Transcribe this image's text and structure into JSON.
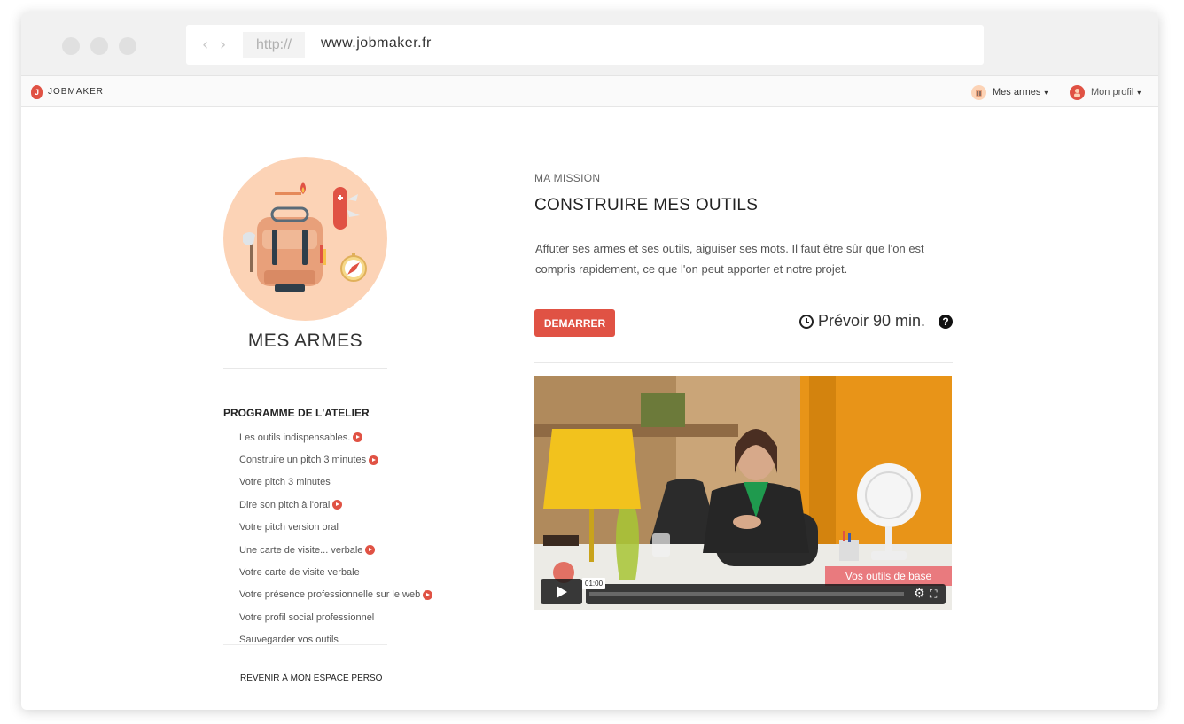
{
  "browser": {
    "protocol": "http://",
    "url": "www.jobmaker.fr",
    "back_glyph": "‹",
    "forward_glyph": "›"
  },
  "topnav": {
    "logo_letter": "J",
    "logo_text": "JOBMAKER",
    "menu_weapons": "Mes armes",
    "menu_profile": "Mon profil",
    "caret": "▾"
  },
  "sidebar": {
    "title": "MES ARMES",
    "program_title": "PROGRAMME DE L'ATELIER",
    "items": [
      {
        "label": "Les outils indispensables.",
        "video": true
      },
      {
        "label": "Construire un pitch 3 minutes",
        "video": true
      },
      {
        "label": "Votre pitch 3 minutes",
        "video": false
      },
      {
        "label": "Dire son pitch à l'oral",
        "video": true
      },
      {
        "label": "Votre pitch version oral",
        "video": false
      },
      {
        "label": "Une carte de visite... verbale",
        "video": true
      },
      {
        "label": "Votre carte de visite verbale",
        "video": false
      },
      {
        "label": "Votre présence professionnelle sur le web",
        "video": true
      },
      {
        "label": "Votre profil social professionnel",
        "video": false
      },
      {
        "label": "Sauvegarder vos outils",
        "video": false
      }
    ],
    "back_link": "REVENIR À MON ESPACE PERSO"
  },
  "mission": {
    "label": "MA MISSION",
    "title": "CONSTRUIRE MES OUTILS",
    "description": "Affuter ses armes et ses outils, aiguiser ses mots. Il faut être sûr que l'on est compris rapidement, ce que l'on peut apporter et notre projet.",
    "start_label": "DEMARRER",
    "duration": "Prévoir 90 min.",
    "help_glyph": "?"
  },
  "video": {
    "caption": "Vos outils de base",
    "timestamp": "01:00",
    "progress": 0.0,
    "gear_glyph": "⚙",
    "fullscreen_glyph": "⛶"
  },
  "colors": {
    "accent": "#e05244",
    "illustration_bg": "#fcd3b6"
  }
}
